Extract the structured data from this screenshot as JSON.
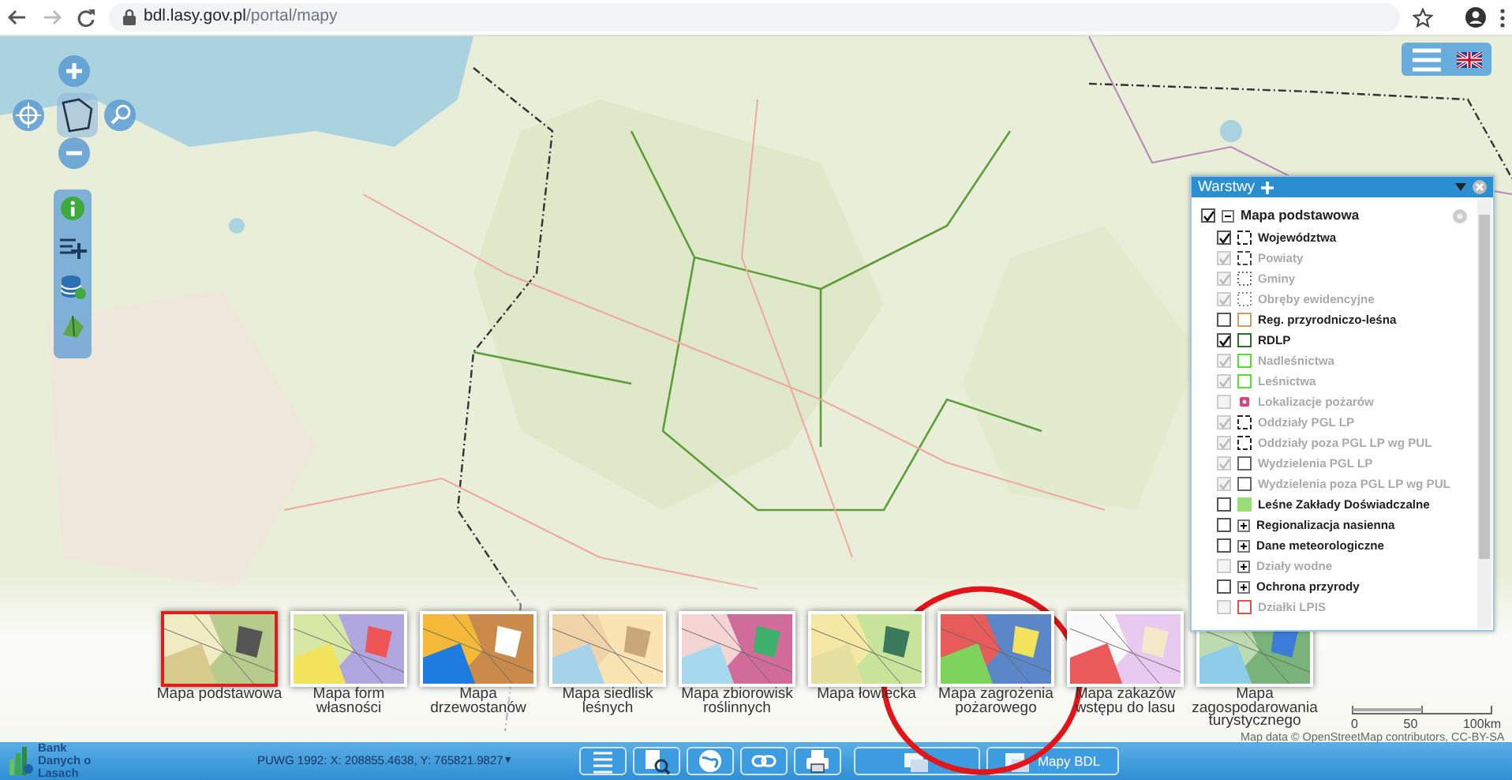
{
  "browser": {
    "url_host": "bdl.lasy.gov.pl",
    "url_path": "/portal/mapy"
  },
  "layers_panel": {
    "title": "Warstwy",
    "layers": [
      {
        "label": "Mapa podstawowa",
        "checked": true,
        "disabled": false,
        "kind": "group",
        "expanded": true,
        "children": [
          {
            "label": "Województwa",
            "checked": true,
            "disabled": false,
            "kind": "dashed",
            "color": "#222222"
          },
          {
            "label": "Powiaty",
            "checked": true,
            "disabled": true,
            "kind": "dashed",
            "color": "#444444"
          },
          {
            "label": "Gminy",
            "checked": true,
            "disabled": true,
            "kind": "dotted",
            "color": "#666666"
          },
          {
            "label": "Obręby ewidencyjne",
            "checked": true,
            "disabled": true,
            "kind": "dotted",
            "color": "#888888"
          },
          {
            "label": "Reg. przyrodniczo-leśna",
            "checked": false,
            "disabled": false,
            "kind": "line",
            "color": "#c8a060"
          },
          {
            "label": "RDLP",
            "checked": true,
            "disabled": false,
            "kind": "line",
            "color": "#2e6b2e"
          },
          {
            "label": "Nadleśnictwa",
            "checked": true,
            "disabled": true,
            "kind": "line",
            "color": "#55dd33"
          },
          {
            "label": "Leśnictwa",
            "checked": true,
            "disabled": true,
            "kind": "line",
            "color": "#55dd33"
          },
          {
            "label": "Lokalizacje pożarów",
            "checked": false,
            "disabled": true,
            "kind": "marker",
            "color": "#e0407a"
          },
          {
            "label": "Oddziały PGL LP",
            "checked": true,
            "disabled": true,
            "kind": "dashed",
            "color": "#222222"
          },
          {
            "label": "Oddziały poza PGL LP wg PUL",
            "checked": true,
            "disabled": true,
            "kind": "dashed",
            "color": "#222222"
          },
          {
            "label": "Wydzielenia PGL LP",
            "checked": true,
            "disabled": true,
            "kind": "line",
            "color": "#666666"
          },
          {
            "label": "Wydzielenia poza PGL LP wg PUL",
            "checked": true,
            "disabled": true,
            "kind": "line",
            "color": "#666666"
          },
          {
            "label": "Leśne Zakłady Doświadczalne",
            "checked": false,
            "disabled": false,
            "kind": "fill",
            "color": "#99dd77"
          },
          {
            "label": "Regionalizacja nasienna",
            "checked": false,
            "disabled": false,
            "kind": "group",
            "expanded": false
          },
          {
            "label": "Dane meteorologiczne",
            "checked": false,
            "disabled": false,
            "kind": "group",
            "expanded": false
          },
          {
            "label": "Działy wodne",
            "checked": false,
            "disabled": true,
            "kind": "group",
            "expanded": false
          },
          {
            "label": "Ochrona przyrody",
            "checked": false,
            "disabled": false,
            "kind": "group",
            "expanded": false
          },
          {
            "label": "Działki LPIS",
            "checked": false,
            "disabled": true,
            "kind": "line",
            "color": "#e05050"
          }
        ]
      }
    ]
  },
  "thumbnails": [
    {
      "label": "Mapa podstawowa",
      "selected": true
    },
    {
      "label": "Mapa form własności",
      "selected": false
    },
    {
      "label": "Mapa drzewostanów",
      "selected": false
    },
    {
      "label": "Mapa siedlisk leśnych",
      "selected": false
    },
    {
      "label": "Mapa zbiorowisk roślinnych",
      "selected": false
    },
    {
      "label": "Mapa łowiecka",
      "selected": false
    },
    {
      "label": "Mapa zagrożenia pożarowego",
      "selected": false
    },
    {
      "label": "Mapa zakazów wstępu do lasu",
      "selected": false
    },
    {
      "label": "Mapa zagospodarowania turystycznego",
      "selected": false
    }
  ],
  "scale_bar": {
    "ticks": [
      "0",
      "50",
      "100km"
    ]
  },
  "attribution": "Map data © OpenStreetMap contributors, CC-BY-SA",
  "status_bar": {
    "logo_text": "Bank Danych o Lasach",
    "coordinates": "PUWG 1992: X: 208855.4638, Y: 765821.9827",
    "caret": "▼",
    "map_button": "Mapy BDL"
  }
}
